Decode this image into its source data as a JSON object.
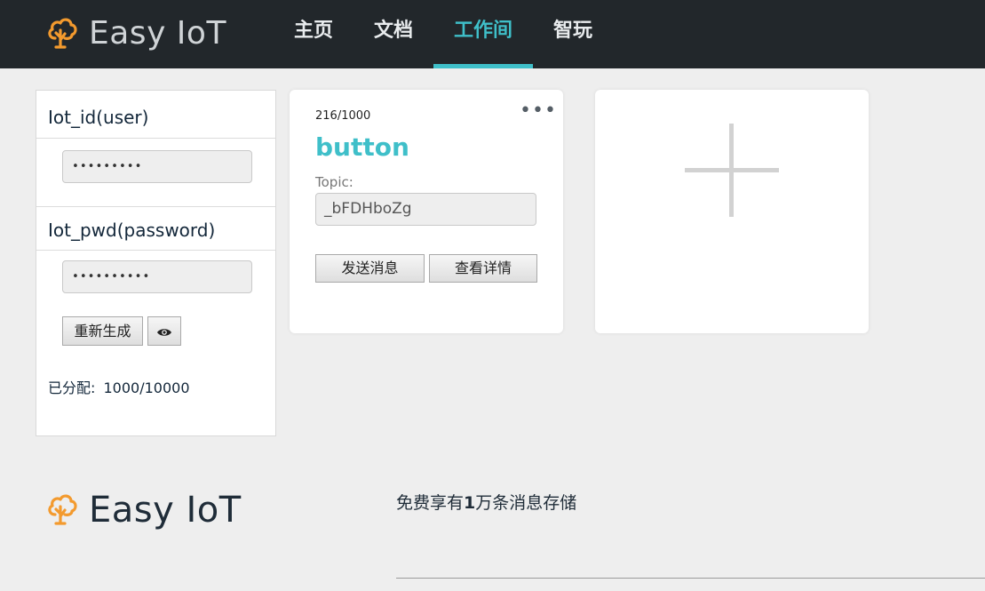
{
  "brand": {
    "name": "Easy IoT",
    "logo_icon": "cloud-tree-icon",
    "accent": "#f39a2e"
  },
  "nav": {
    "items": [
      {
        "label": "主页",
        "active": false
      },
      {
        "label": "文档",
        "active": false
      },
      {
        "label": "工作间",
        "active": true
      },
      {
        "label": "智玩",
        "active": false
      }
    ],
    "active_color": "#3fbfc9"
  },
  "credentials": {
    "id_label": "Iot_id(user)",
    "id_value": "•••••••••",
    "pwd_label": "Iot_pwd(password)",
    "pwd_value": "••••••••••",
    "regenerate_label": "重新生成",
    "reveal_icon": "eye-icon",
    "reveal_glyph": "👁",
    "allocated_label": "已分配:",
    "allocated_value": "1000/10000"
  },
  "device_card": {
    "count": "216/1000",
    "menu_glyph": "•••",
    "name": "button",
    "topic_label": "Topic:",
    "topic_value": "_bFDHboZg",
    "send_label": "发送消息",
    "detail_label": "查看详情"
  },
  "add_card": {
    "icon": "plus-icon"
  },
  "footer": {
    "logo_text": "Easy IoT",
    "tagline_before": "免费享有",
    "tagline_bold": "1",
    "tagline_after": "万条消息存储"
  }
}
